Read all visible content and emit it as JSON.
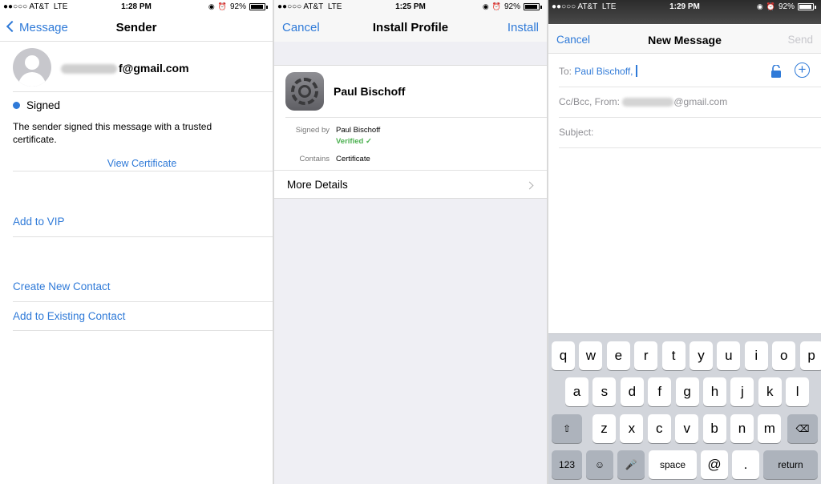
{
  "status": {
    "carrier": "●●○○○ AT&T",
    "network": "LTE",
    "battery": "92%",
    "time_p1": "1:28 PM",
    "time_p2": "1:25 PM",
    "time_p3": "1:29 PM"
  },
  "sender_screen": {
    "back_label": "Message",
    "title": "Sender",
    "email_visible": "f@gmail.com",
    "signed_label": "Signed",
    "signed_description": "The sender signed this message with a trusted certificate.",
    "view_certificate": "View Certificate",
    "add_to_vip": "Add to VIP",
    "create_new_contact": "Create New Contact",
    "add_to_existing_contact": "Add to Existing Contact"
  },
  "install_profile_screen": {
    "cancel_label": "Cancel",
    "title": "Install Profile",
    "install_label": "Install",
    "profile_name": "Paul Bischoff",
    "signed_by_label": "Signed by",
    "signed_by_value": "Paul Bischoff",
    "verified_label": "Verified ✓",
    "contains_label": "Contains",
    "contains_value": "Certificate",
    "more_details": "More Details"
  },
  "new_message_screen": {
    "cancel_label": "Cancel",
    "title": "New Message",
    "send_label": "Send",
    "to_label": "To:",
    "to_value": "Paul Bischoff,",
    "ccbcc_label": "Cc/Bcc, From:",
    "from_visible": "@gmail.com",
    "subject_label": "Subject:"
  },
  "keyboard": {
    "row1": [
      "q",
      "w",
      "e",
      "r",
      "t",
      "y",
      "u",
      "i",
      "o",
      "p"
    ],
    "row2": [
      "a",
      "s",
      "d",
      "f",
      "g",
      "h",
      "j",
      "k",
      "l"
    ],
    "row3": [
      "z",
      "x",
      "c",
      "v",
      "b",
      "n",
      "m"
    ],
    "shift": "⇧",
    "delete": "⌫",
    "numbers": "123",
    "emoji": "☺",
    "mic": "🎤",
    "space": "space",
    "at": "@",
    "period": ".",
    "return": "return"
  },
  "colors": {
    "accent": "#2f7ad8",
    "verified": "#4cb050"
  }
}
